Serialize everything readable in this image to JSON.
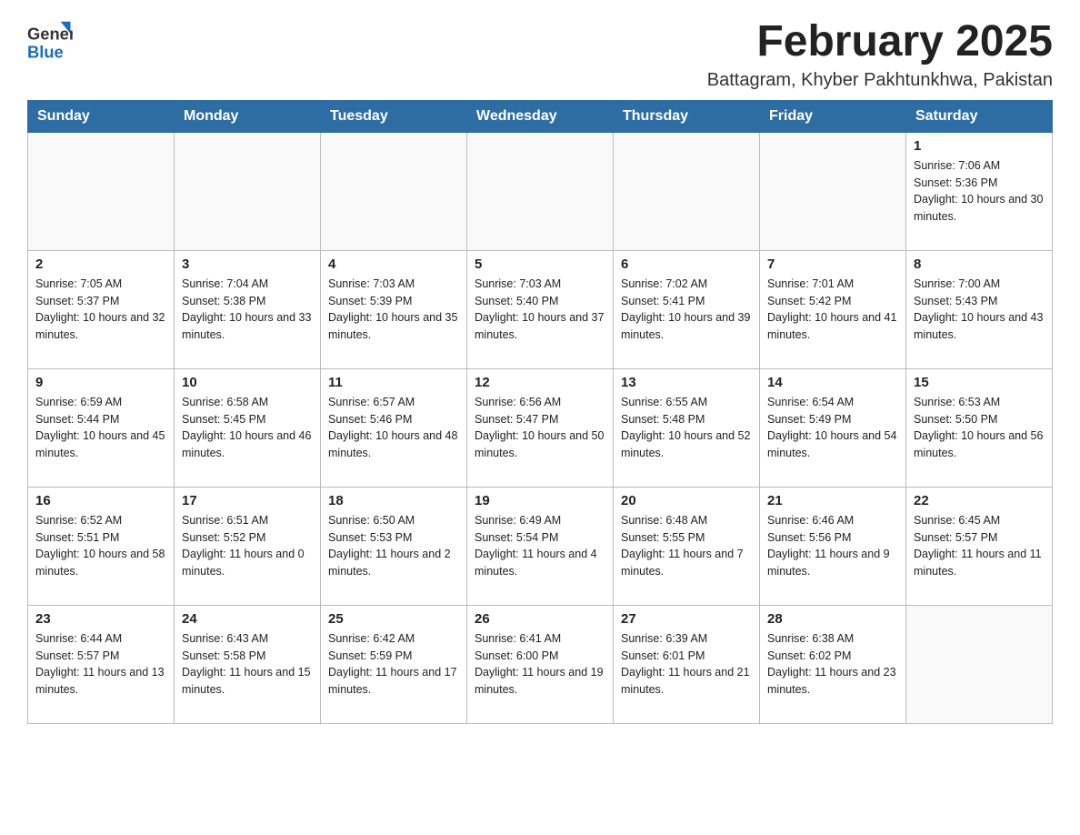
{
  "logo": {
    "general": "General",
    "blue": "Blue"
  },
  "title": "February 2025",
  "subtitle": "Battagram, Khyber Pakhtunkhwa, Pakistan",
  "weekdays": [
    "Sunday",
    "Monday",
    "Tuesday",
    "Wednesday",
    "Thursday",
    "Friday",
    "Saturday"
  ],
  "weeks": [
    [
      {
        "day": "",
        "info": ""
      },
      {
        "day": "",
        "info": ""
      },
      {
        "day": "",
        "info": ""
      },
      {
        "day": "",
        "info": ""
      },
      {
        "day": "",
        "info": ""
      },
      {
        "day": "",
        "info": ""
      },
      {
        "day": "1",
        "info": "Sunrise: 7:06 AM\nSunset: 5:36 PM\nDaylight: 10 hours and 30 minutes."
      }
    ],
    [
      {
        "day": "2",
        "info": "Sunrise: 7:05 AM\nSunset: 5:37 PM\nDaylight: 10 hours and 32 minutes."
      },
      {
        "day": "3",
        "info": "Sunrise: 7:04 AM\nSunset: 5:38 PM\nDaylight: 10 hours and 33 minutes."
      },
      {
        "day": "4",
        "info": "Sunrise: 7:03 AM\nSunset: 5:39 PM\nDaylight: 10 hours and 35 minutes."
      },
      {
        "day": "5",
        "info": "Sunrise: 7:03 AM\nSunset: 5:40 PM\nDaylight: 10 hours and 37 minutes."
      },
      {
        "day": "6",
        "info": "Sunrise: 7:02 AM\nSunset: 5:41 PM\nDaylight: 10 hours and 39 minutes."
      },
      {
        "day": "7",
        "info": "Sunrise: 7:01 AM\nSunset: 5:42 PM\nDaylight: 10 hours and 41 minutes."
      },
      {
        "day": "8",
        "info": "Sunrise: 7:00 AM\nSunset: 5:43 PM\nDaylight: 10 hours and 43 minutes."
      }
    ],
    [
      {
        "day": "9",
        "info": "Sunrise: 6:59 AM\nSunset: 5:44 PM\nDaylight: 10 hours and 45 minutes."
      },
      {
        "day": "10",
        "info": "Sunrise: 6:58 AM\nSunset: 5:45 PM\nDaylight: 10 hours and 46 minutes."
      },
      {
        "day": "11",
        "info": "Sunrise: 6:57 AM\nSunset: 5:46 PM\nDaylight: 10 hours and 48 minutes."
      },
      {
        "day": "12",
        "info": "Sunrise: 6:56 AM\nSunset: 5:47 PM\nDaylight: 10 hours and 50 minutes."
      },
      {
        "day": "13",
        "info": "Sunrise: 6:55 AM\nSunset: 5:48 PM\nDaylight: 10 hours and 52 minutes."
      },
      {
        "day": "14",
        "info": "Sunrise: 6:54 AM\nSunset: 5:49 PM\nDaylight: 10 hours and 54 minutes."
      },
      {
        "day": "15",
        "info": "Sunrise: 6:53 AM\nSunset: 5:50 PM\nDaylight: 10 hours and 56 minutes."
      }
    ],
    [
      {
        "day": "16",
        "info": "Sunrise: 6:52 AM\nSunset: 5:51 PM\nDaylight: 10 hours and 58 minutes."
      },
      {
        "day": "17",
        "info": "Sunrise: 6:51 AM\nSunset: 5:52 PM\nDaylight: 11 hours and 0 minutes."
      },
      {
        "day": "18",
        "info": "Sunrise: 6:50 AM\nSunset: 5:53 PM\nDaylight: 11 hours and 2 minutes."
      },
      {
        "day": "19",
        "info": "Sunrise: 6:49 AM\nSunset: 5:54 PM\nDaylight: 11 hours and 4 minutes."
      },
      {
        "day": "20",
        "info": "Sunrise: 6:48 AM\nSunset: 5:55 PM\nDaylight: 11 hours and 7 minutes."
      },
      {
        "day": "21",
        "info": "Sunrise: 6:46 AM\nSunset: 5:56 PM\nDaylight: 11 hours and 9 minutes."
      },
      {
        "day": "22",
        "info": "Sunrise: 6:45 AM\nSunset: 5:57 PM\nDaylight: 11 hours and 11 minutes."
      }
    ],
    [
      {
        "day": "23",
        "info": "Sunrise: 6:44 AM\nSunset: 5:57 PM\nDaylight: 11 hours and 13 minutes."
      },
      {
        "day": "24",
        "info": "Sunrise: 6:43 AM\nSunset: 5:58 PM\nDaylight: 11 hours and 15 minutes."
      },
      {
        "day": "25",
        "info": "Sunrise: 6:42 AM\nSunset: 5:59 PM\nDaylight: 11 hours and 17 minutes."
      },
      {
        "day": "26",
        "info": "Sunrise: 6:41 AM\nSunset: 6:00 PM\nDaylight: 11 hours and 19 minutes."
      },
      {
        "day": "27",
        "info": "Sunrise: 6:39 AM\nSunset: 6:01 PM\nDaylight: 11 hours and 21 minutes."
      },
      {
        "day": "28",
        "info": "Sunrise: 6:38 AM\nSunset: 6:02 PM\nDaylight: 11 hours and 23 minutes."
      },
      {
        "day": "",
        "info": ""
      }
    ]
  ]
}
